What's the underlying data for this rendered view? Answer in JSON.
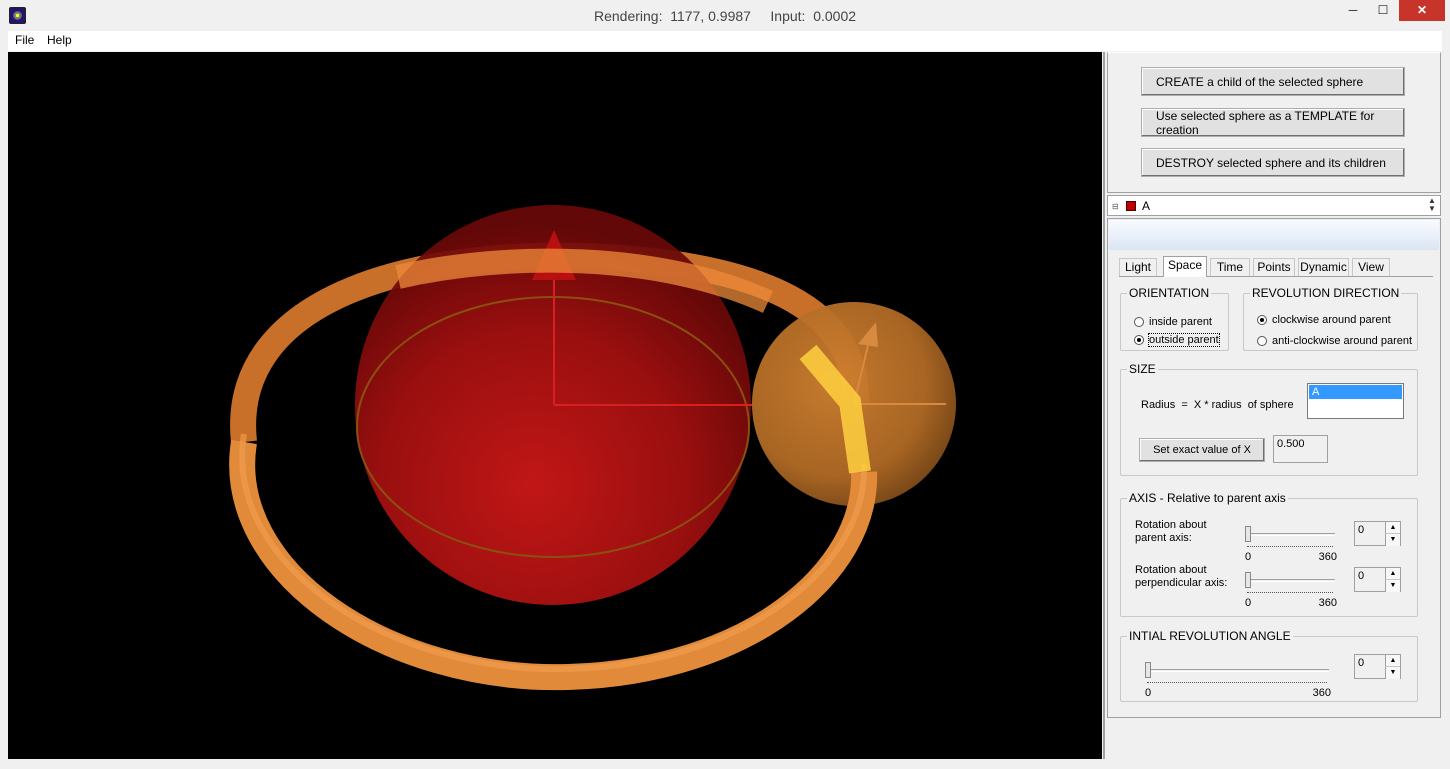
{
  "window": {
    "title": "Rendering:  1177, 0.9987     Input:  0.0002",
    "minimize_glyph": "─",
    "maximize_glyph": "☐",
    "close_glyph": "✕"
  },
  "menu": {
    "file": "File",
    "help": "Help"
  },
  "actions": {
    "create": "CREATE  a child of the selected sphere",
    "template": "Use selected sphere as a TEMPLATE for creation",
    "destroy": "DESTROY selected sphere and its children"
  },
  "tree": {
    "expander": "⊟",
    "selected": "A",
    "selected_color": "#c00000"
  },
  "tabs": [
    {
      "label": "Light"
    },
    {
      "label": "Space",
      "active": true
    },
    {
      "label": "Time"
    },
    {
      "label": "Points"
    },
    {
      "label": "Dynamic"
    },
    {
      "label": "View"
    }
  ],
  "orientation": {
    "title": "ORIENTATION",
    "inside_label": "inside parent",
    "outside_label": "outside parent",
    "selected": "outside"
  },
  "revolution": {
    "title": "REVOLUTION  DIRECTION",
    "cw_label": "clockwise around parent",
    "acw_label": "anti-clockwise around parent",
    "selected": "clockwise"
  },
  "size": {
    "title": "SIZE",
    "formula": "Radius  =  X * radius  of sphere",
    "list_selected": "A",
    "set_button": "Set exact value of X",
    "x_value": "0.500"
  },
  "axis": {
    "title": "AXIS - Relative to parent axis",
    "parent_label": "Rotation about\nparent axis:",
    "parent_min": "0",
    "parent_max": "360",
    "parent_value": "0",
    "perp_label": "Rotation about\nperpendicular axis:",
    "perp_min": "0",
    "perp_max": "360",
    "perp_value": "0"
  },
  "initial": {
    "title": "INTIAL REVOLUTION ANGLE",
    "min": "0",
    "max": "360",
    "value": "0"
  },
  "spin_glyphs": {
    "up": "▲",
    "down": "▼"
  },
  "colors": {
    "viewport_bg": "#000000",
    "parent_sphere": "#b01010",
    "child_sphere": "#e08a30",
    "orbit_ring": "#e0893a",
    "close_button": "#c7342a",
    "selection": "#3399ff"
  }
}
